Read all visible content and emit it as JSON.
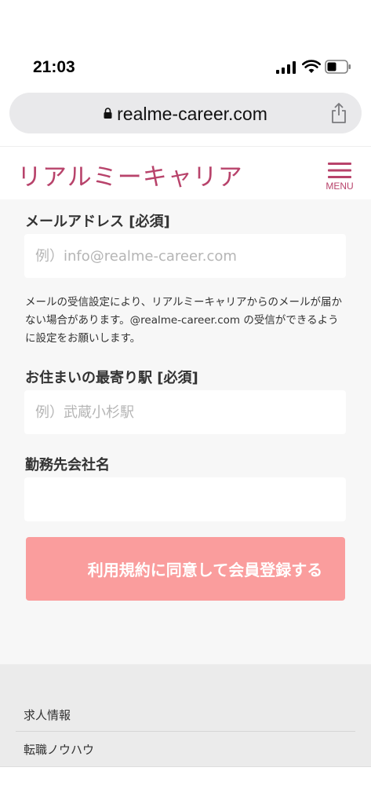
{
  "status_bar": {
    "time": "21:03"
  },
  "browser": {
    "url": "realme-career.com"
  },
  "header": {
    "brand": "リアルミーキャリア",
    "menu_label": "MENU"
  },
  "form": {
    "email": {
      "label": "メールアドレス [必須]",
      "placeholder": "例）info@realme-career.com"
    },
    "email_note": "メールの受信設定により、リアルミーキャリアからのメールが届かない場合があります。@realme-career.com の受信ができるように設定をお願いします。",
    "station": {
      "label": "お住まいの最寄り駅 [必須]",
      "placeholder": "例）武蔵小杉駅"
    },
    "company": {
      "label": "勤務先会社名",
      "placeholder": ""
    },
    "submit_label": "利用規約に同意して会員登録する"
  },
  "footer": {
    "links": [
      "求人情報",
      "転職ノウハウ"
    ]
  },
  "colors": {
    "brand": "#b8436b",
    "submit": "#fa9d9d",
    "form_bg": "#f7f7f7",
    "footer_bg": "#ebebeb"
  }
}
